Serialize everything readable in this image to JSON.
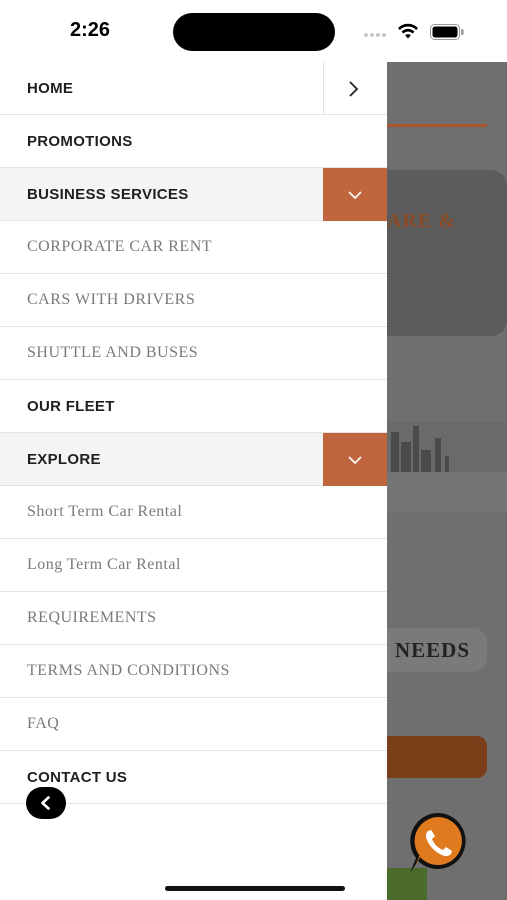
{
  "status_bar": {
    "time": "2:26"
  },
  "menu": {
    "home": "HOME",
    "promotions": "PROMOTIONS",
    "business_services": "BUSINESS SERVICES",
    "corporate_car_rent": "CORPORATE CAR RENT",
    "cars_with_drivers": "CARS WITH DRIVERS",
    "shuttle_and_buses": "SHUTTLE AND BUSES",
    "our_fleet": "OUR FLEET",
    "explore": "EXPLORE",
    "short_term": "Short Term Car Rental",
    "long_term": "Long Term Car Rental",
    "requirements": "REQUIREMENTS",
    "terms": "TERMS AND CONDITIONS",
    "faq": "FAQ",
    "contact_us": "CONTACT US"
  },
  "background": {
    "card_text": "ARE &",
    "needs_text": "NEEDS"
  },
  "icons": {
    "home_chevron": "chevron-right-icon",
    "expand": "chevron-down-icon",
    "back": "chevron-left-icon",
    "whatsapp": "whatsapp-icon"
  },
  "colors": {
    "accent": "#c0663f",
    "overlay": "#6f6f6f",
    "whatsapp_orange": "#e07a1f"
  }
}
